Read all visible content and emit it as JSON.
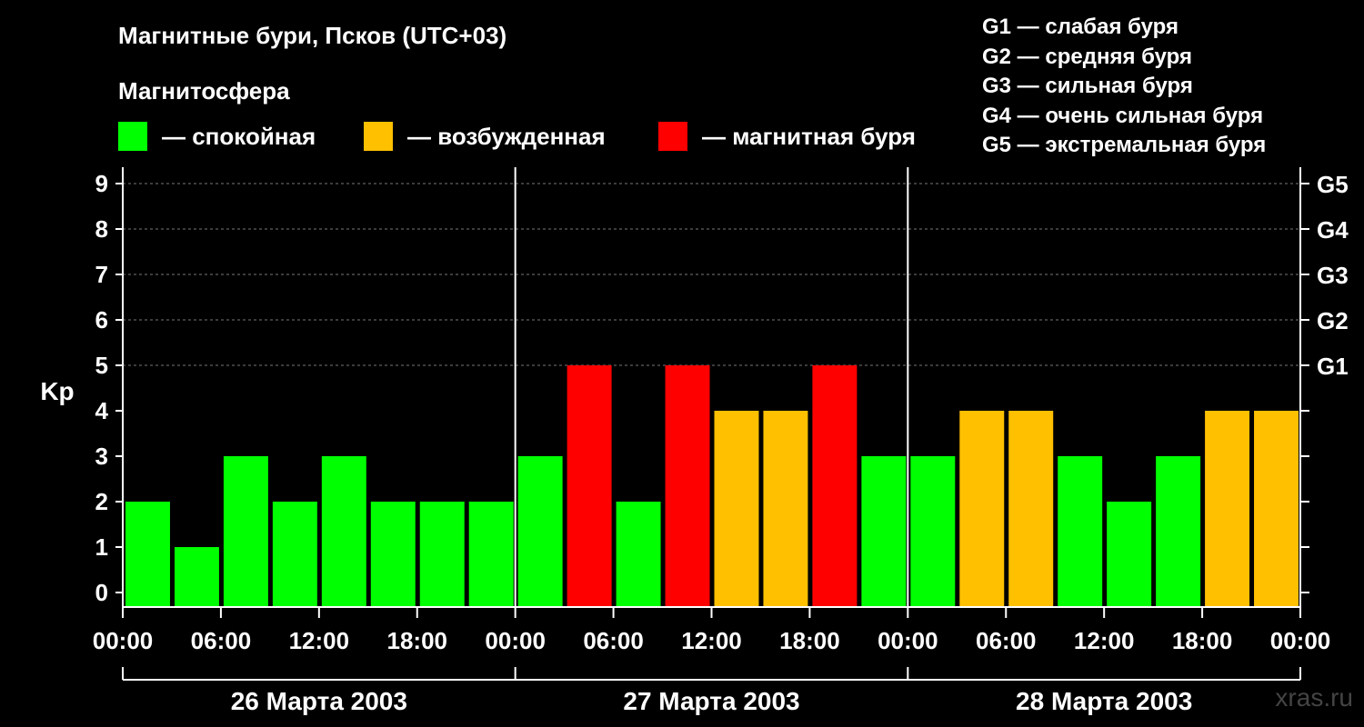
{
  "title": "Магнитные бури, Псков (UTC+03)",
  "subtitle": "Магнитосфера",
  "legend": [
    {
      "label": "— спокойная",
      "color": "#00ff00"
    },
    {
      "label": "— возбужденная",
      "color": "#ffc000"
    },
    {
      "label": "— магнитная буря",
      "color": "#ff0000"
    }
  ],
  "g_scale": [
    "G1 — слабая буря",
    "G2 — средняя буря",
    "G3 — сильная буря",
    "G4 — очень сильная буря",
    "G5 — экстремальная буря"
  ],
  "credit": "xras.ru",
  "chart_data": {
    "type": "bar",
    "ylabel": "Kp",
    "ylim": [
      0,
      9
    ],
    "y_ticks": [
      0,
      1,
      2,
      3,
      4,
      5,
      6,
      7,
      8,
      9
    ],
    "right_ticks": [
      {
        "kp": 5,
        "label": "G1"
      },
      {
        "kp": 6,
        "label": "G2"
      },
      {
        "kp": 7,
        "label": "G3"
      },
      {
        "kp": 8,
        "label": "G4"
      },
      {
        "kp": 9,
        "label": "G5"
      }
    ],
    "grid": "dashed horizontal at Kp 5–9",
    "x_tick_labels": [
      "00:00",
      "06:00",
      "12:00",
      "18:00",
      "00:00",
      "06:00",
      "12:00",
      "18:00",
      "00:00",
      "06:00",
      "12:00",
      "18:00",
      "00:00"
    ],
    "days": [
      "26 Марта 2003",
      "27 Марта 2003",
      "28 Марта 2003"
    ],
    "interval_hours": 3,
    "values": [
      2,
      1,
      3,
      2,
      3,
      2,
      2,
      2,
      3,
      5,
      2,
      5,
      4,
      4,
      5,
      3,
      3,
      4,
      4,
      3,
      2,
      3,
      4,
      4
    ],
    "colors": {
      "quiet": "#00ff00",
      "active": "#ffc000",
      "storm": "#ff0000"
    },
    "color_rule": "Kp<=3 quiet, Kp=4 active, Kp>=5 storm"
  }
}
